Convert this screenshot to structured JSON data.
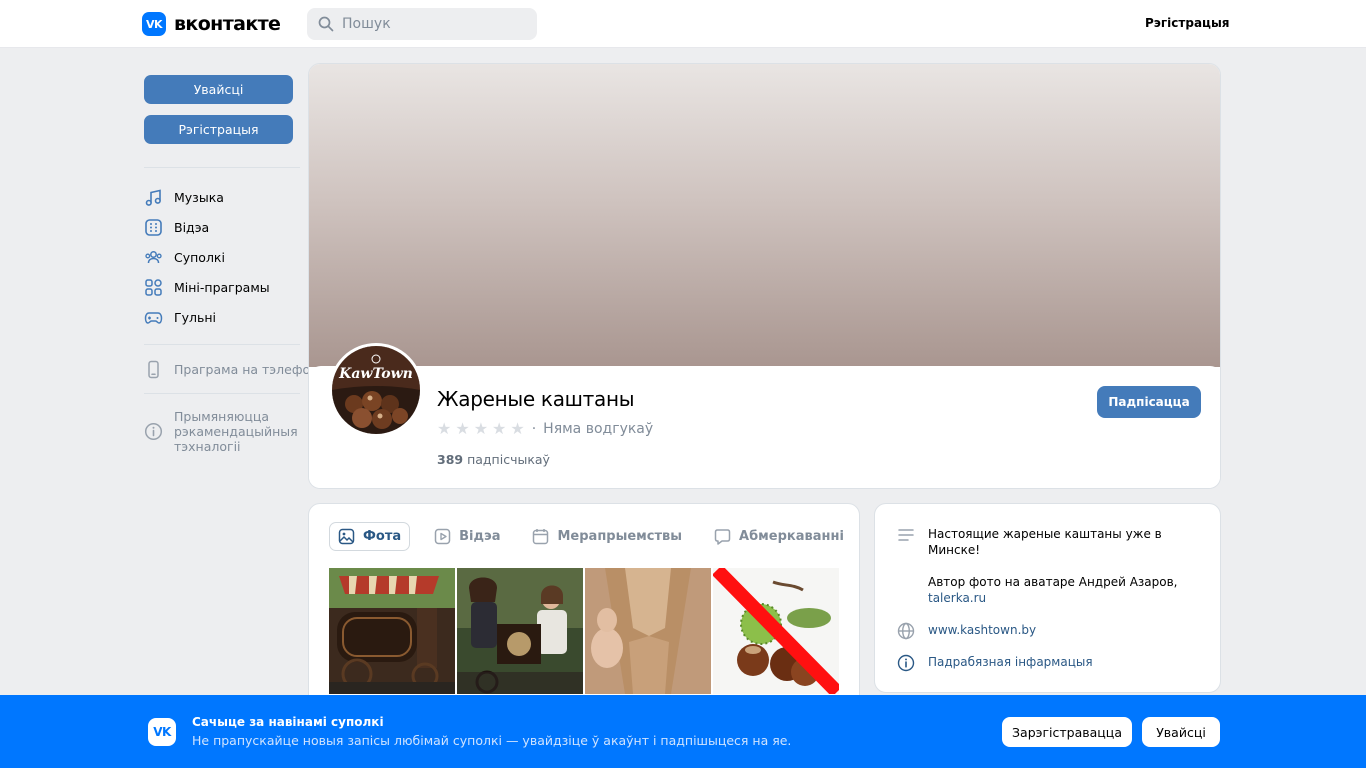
{
  "header": {
    "logo_mark": "VK",
    "logo_text": "вконтакте",
    "search_placeholder": "Пошук",
    "register_link": "Рэгістрацыя"
  },
  "sidebar": {
    "login_button": "Увайсці",
    "register_button": "Рэгістрацыя",
    "items": [
      {
        "label": "Музыка",
        "icon": "music-icon"
      },
      {
        "label": "Відэа",
        "icon": "video-icon"
      },
      {
        "label": "Суполкі",
        "icon": "groups-icon"
      },
      {
        "label": "Міні-праграмы",
        "icon": "mini-apps-icon"
      },
      {
        "label": "Гульні",
        "icon": "gamepad-icon"
      }
    ],
    "phone_app": "Праграма на тэлефон",
    "recommendations": [
      "Прымяняюцца",
      "рэкамендацыйныя",
      "тэхналогіі"
    ]
  },
  "group": {
    "name": "Жареные каштаны",
    "rating_label": "Няма водгукаў",
    "rating_separator": "·",
    "subscribers_count": "389",
    "subscribers_label": "падпісчыкаў",
    "subscribe_button": "Падпісацца",
    "avatar_logo_text": "KawTown"
  },
  "media": {
    "tabs": [
      {
        "label": "Фота",
        "icon": "photo-icon",
        "active": true
      },
      {
        "label": "Відэа",
        "icon": "video-play-icon",
        "active": false
      },
      {
        "label": "Мерапрыемствы",
        "icon": "calendar-icon",
        "active": false
      },
      {
        "label": "Абмеркаванні",
        "icon": "chat-bubble-icon",
        "active": false
      }
    ]
  },
  "info": {
    "description_line1": "Настоящие жареные каштаны уже в Минске!",
    "description_line2": "Автор фото на аватаре Андрей Азаров,",
    "description_link": "talerka.ru",
    "website": "www.kashtown.by",
    "more_info": "Падрабязная інфармацыя"
  },
  "banner": {
    "logo_mark": "VK",
    "title": "Сачыце за навінамі суполкі",
    "text": "Не прапускайце новыя запісы любімай суполкі — увайдзіце ў акаўнт і падпішыцеся на яе.",
    "register_button": "Зарэгістравацца",
    "login_button": "Увайсці"
  },
  "colors": {
    "accent": "#447bba",
    "brand_blue": "#0077ff",
    "link": "#2a5885",
    "background": "#edeef0"
  }
}
